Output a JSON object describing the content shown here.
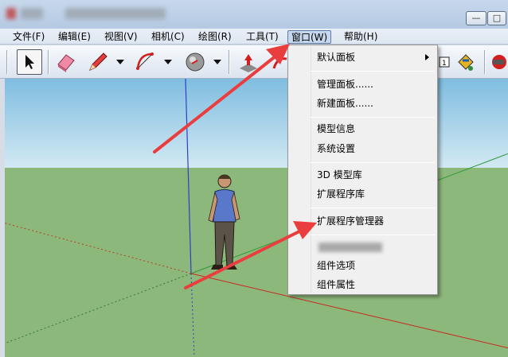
{
  "menubar": {
    "items": [
      {
        "label": "文件(F)"
      },
      {
        "label": "编辑(E)"
      },
      {
        "label": "视图(V)"
      },
      {
        "label": "相机(C)"
      },
      {
        "label": "绘图(R)"
      },
      {
        "label": "工具(T)"
      },
      {
        "label": "窗口(W)"
      },
      {
        "label": "帮助(H)"
      }
    ]
  },
  "window_menu": {
    "items": [
      {
        "label": "默认面板",
        "has_submenu": true
      },
      {
        "label": "管理面板......"
      },
      {
        "label": "新建面板......"
      },
      {
        "label": "模型信息"
      },
      {
        "label": "系统设置"
      },
      {
        "label": "3D 模型库"
      },
      {
        "label": "扩展程序库"
      },
      {
        "label": "扩展程序管理器"
      },
      {
        "label": "组件选项"
      },
      {
        "label": "组件属性"
      }
    ]
  },
  "window_controls": {
    "minimize": "—",
    "maximize": "□"
  },
  "colors": {
    "accent_arrow": "#ea3e3e",
    "sky": "#a5cfe6",
    "ground": "#8db87b",
    "menu_bg": "#f0f0f0"
  },
  "toolbar": {
    "icons": [
      "select-arrow-icon",
      "eraser-icon",
      "pencil-icon",
      "arc-icon",
      "orbit-icon",
      "push-pull-icon",
      "extension-icon"
    ]
  }
}
